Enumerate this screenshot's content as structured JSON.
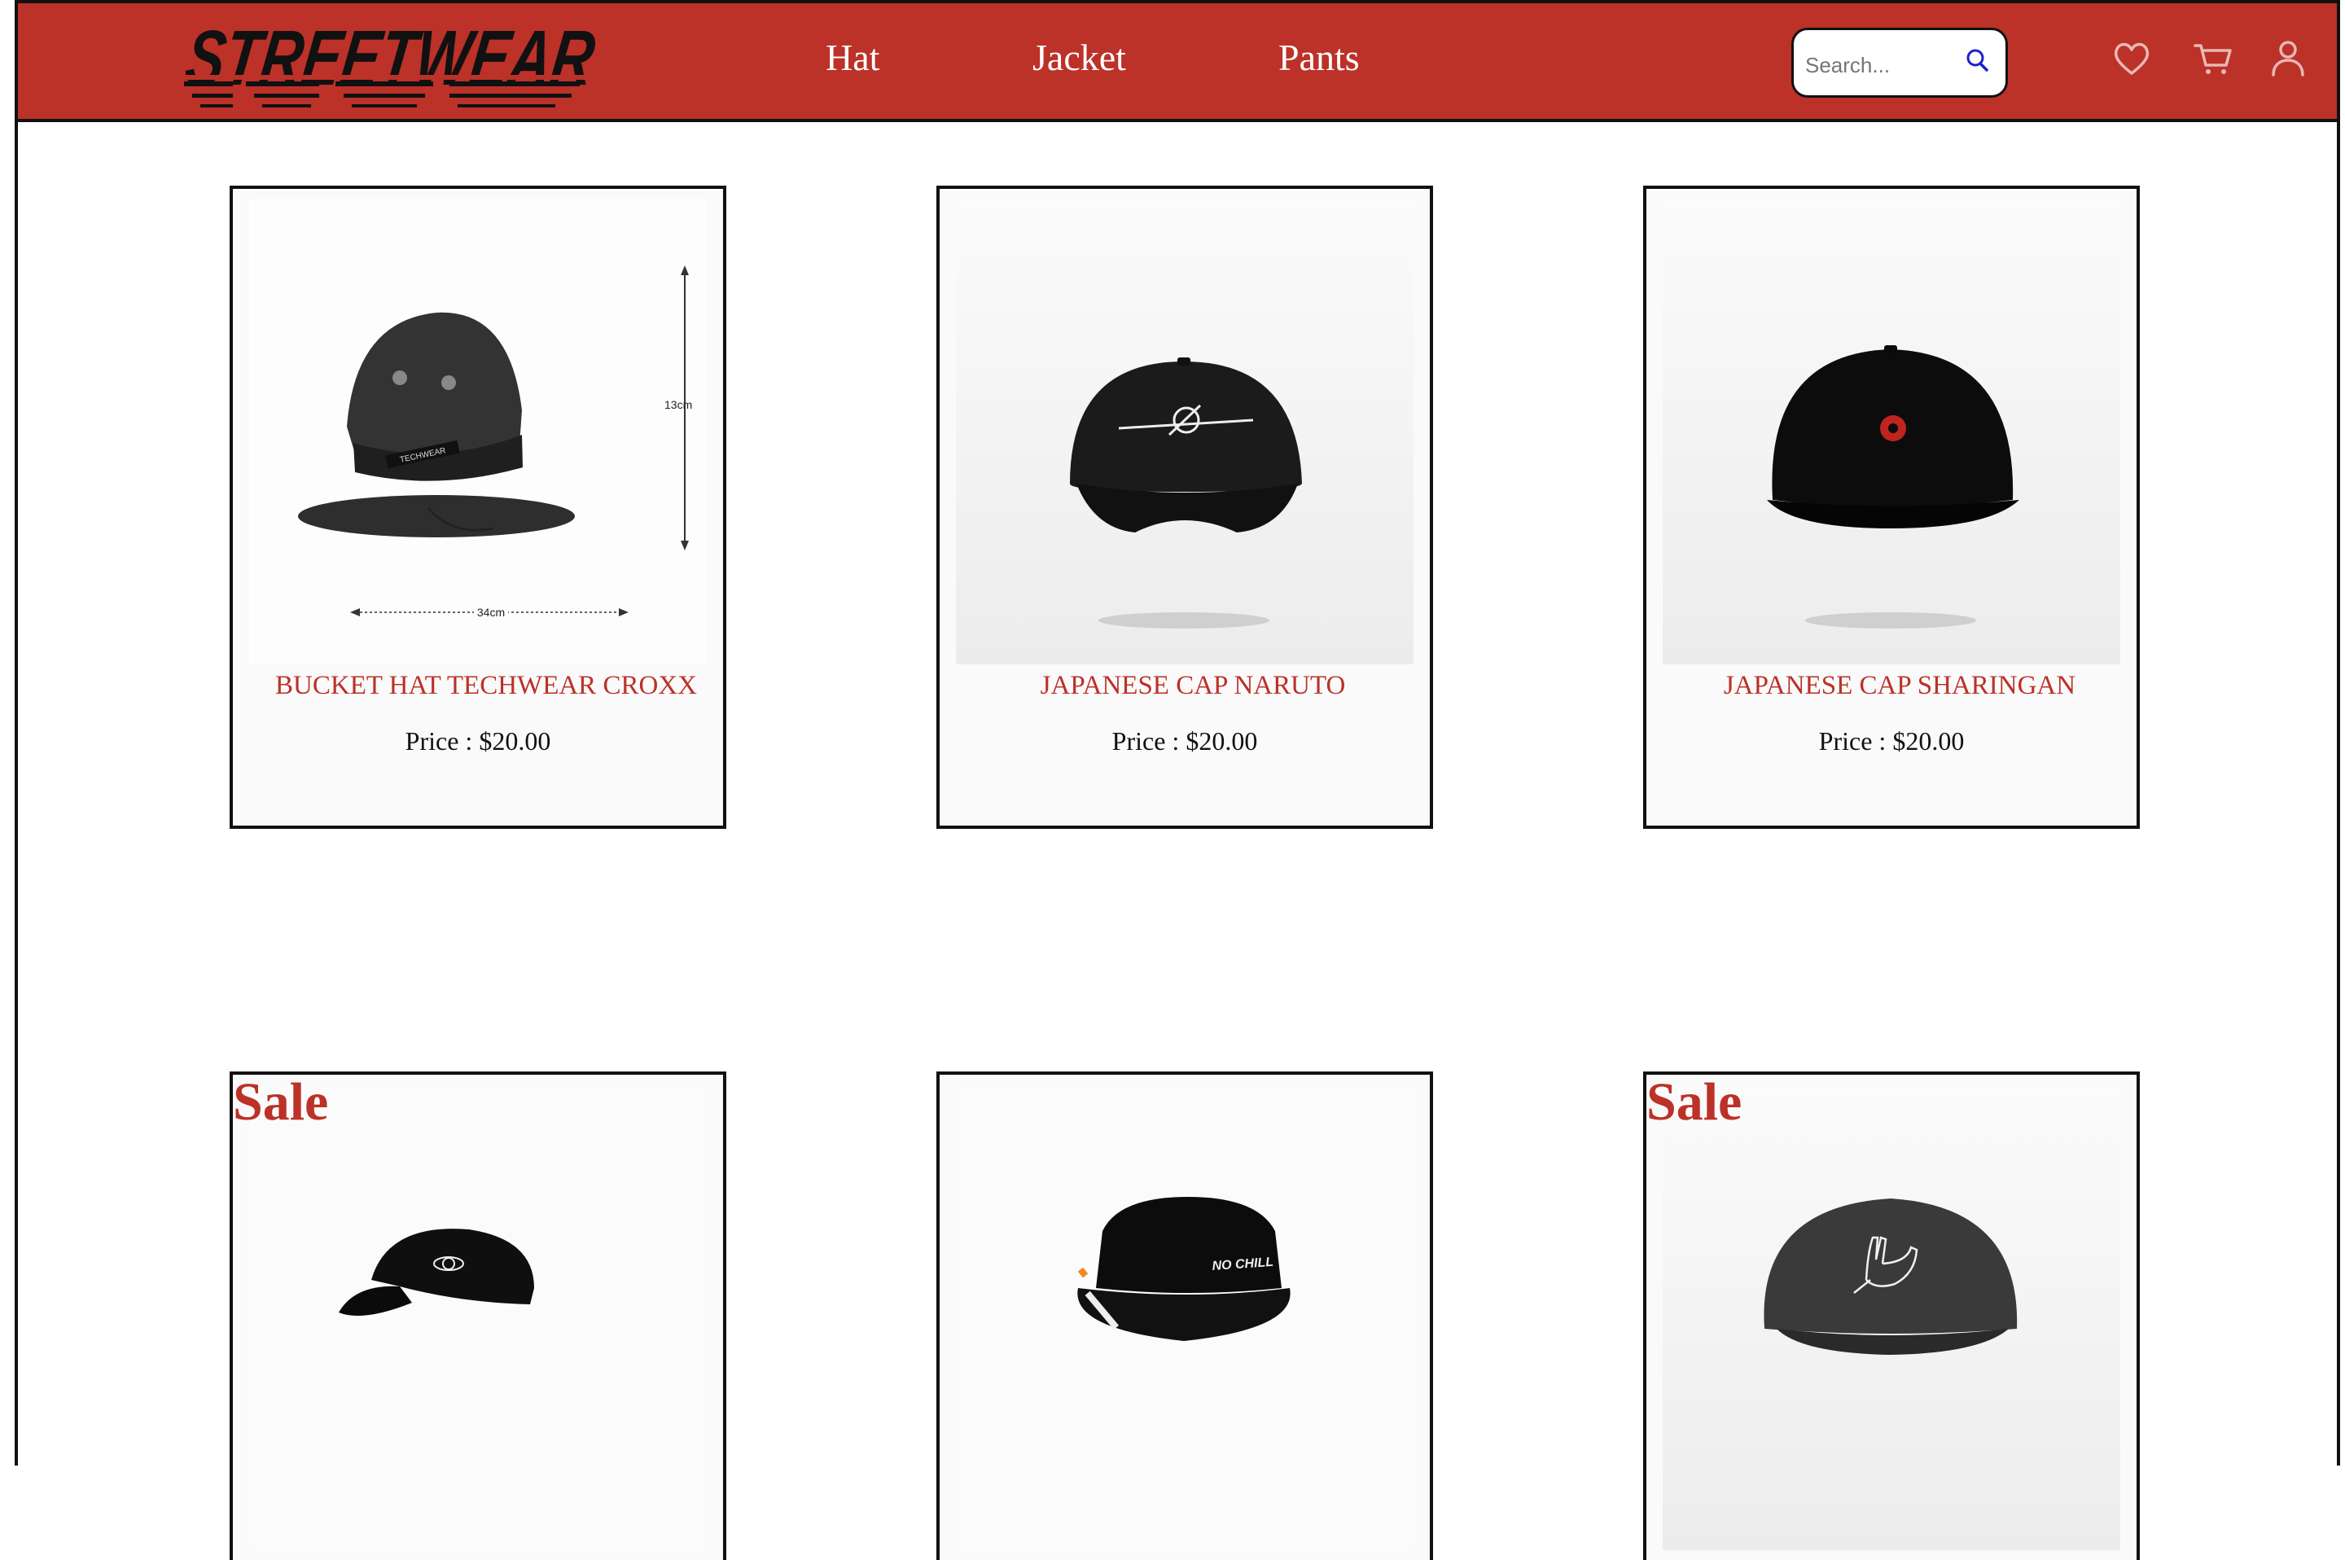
{
  "brand": {
    "logo_text": "STREETWEAR"
  },
  "nav": {
    "items": [
      "Hat",
      "Jacket",
      "Pants"
    ]
  },
  "search": {
    "placeholder": "Search..."
  },
  "colors": {
    "brand_red": "#bc3128",
    "text_dark": "#111111"
  },
  "header_icons": [
    "heart-icon",
    "cart-icon",
    "user-icon"
  ],
  "products": [
    {
      "title": "BUCKET HAT TECHWEAR CROXX",
      "price": "Price : $20.00",
      "dim_height": "13cm",
      "dim_width": "34cm",
      "label": "TECHWEAR"
    },
    {
      "title": "JAPANESE CAP NARUTO",
      "price": "Price : $20.00"
    },
    {
      "title": "JAPANESE CAP SHARINGAN",
      "price": "Price : $20.00"
    },
    {
      "badge": "Sale"
    },
    {
      "hat_text": "NO CHILL"
    },
    {
      "badge": "Sale"
    }
  ]
}
